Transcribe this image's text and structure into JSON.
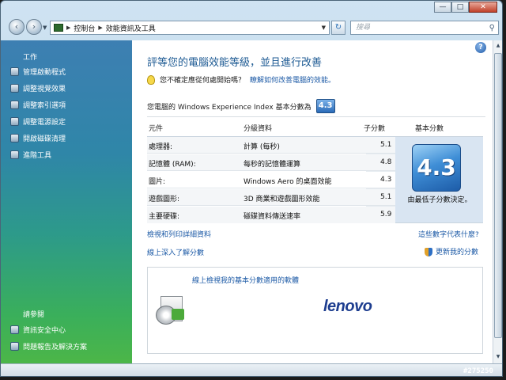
{
  "titlebar": {
    "minimize": "—",
    "maximize": "□",
    "close": "✕"
  },
  "nav": {
    "back": "‹",
    "forward": "›",
    "breadcrumb": [
      "控制台",
      "效能資訊及工具"
    ],
    "search_placeholder": "搜尋"
  },
  "sidebar": {
    "tasks_title": "工作",
    "items": [
      {
        "label": "管理啟動程式",
        "icon": "startup-icon"
      },
      {
        "label": "調整視覺效果",
        "icon": "visual-effects-icon"
      },
      {
        "label": "調整索引選項",
        "icon": "index-icon"
      },
      {
        "label": "調整電源設定",
        "icon": "power-icon"
      },
      {
        "label": "開啟磁碟清理",
        "icon": "disk-cleanup-icon"
      },
      {
        "label": "進階工具",
        "icon": "advanced-tools-icon"
      }
    ],
    "see_also_title": "請參閱",
    "see_also": [
      {
        "label": "資訊安全中心",
        "icon": "security-center-icon"
      },
      {
        "label": "問題報告及解決方案",
        "icon": "problem-reports-icon"
      }
    ]
  },
  "main": {
    "title": "評等您的電腦效能等級，並且進行改善",
    "tip_text": "您不確定應從何處開始嗎？",
    "tip_link": "瞭解如何改善電腦的效能。",
    "score_label": "您電腦的 Windows Experience Index 基本分數為",
    "score_badge": "4.3",
    "columns": {
      "component": "元件",
      "rated": "分級資料",
      "subscore": "子分數",
      "base": "基本分數"
    },
    "rows": [
      {
        "component": "處理器:",
        "rated": "計算 (每秒)",
        "subscore": "5.1"
      },
      {
        "component": "記憶體 (RAM):",
        "rated": "每秒的記憶體運算",
        "subscore": "4.8"
      },
      {
        "component": "圖片:",
        "rated": "Windows Aero 的桌面效能",
        "subscore": "4.3"
      },
      {
        "component": "遊戲圖形:",
        "rated": "3D 商業和遊戲圖形效能",
        "subscore": "5.1"
      },
      {
        "component": "主要硬碟:",
        "rated": "磁碟資料傳送速率",
        "subscore": "5.9"
      }
    ],
    "base_score": "4.3",
    "base_caption": "由最低子分數決定。",
    "link_print": "檢視和列印詳細資料",
    "link_meaning": "這些數字代表什麼?",
    "link_learn": "線上深入了解分數",
    "link_update": "更新我的分數",
    "promo_link": "線上檢視我的基本分數適用的軟體",
    "promo_brand": "lenovo"
  },
  "watermark": "#275250"
}
